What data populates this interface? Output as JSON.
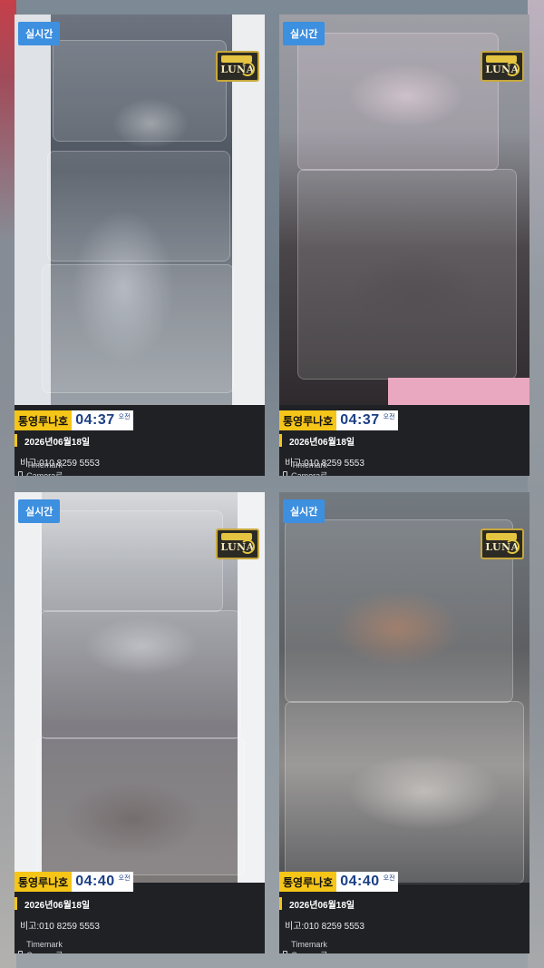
{
  "tiles": [
    {
      "badge": "실시간",
      "logo_text": "LUNA",
      "boat": "통영루나호",
      "time": "04:37",
      "ampm": "오전",
      "date": "2026년06월18일",
      "note": "비고:010 8259 5553",
      "verify": "Timemark Camera로 확인된 시간"
    },
    {
      "badge": "실시간",
      "logo_text": "LUNA",
      "boat": "통영루나호",
      "time": "04:37",
      "ampm": "오전",
      "date": "2026년06월18일",
      "note": "비고:010 8259 5553",
      "verify": "Timemark Camera로 확인된 시간"
    },
    {
      "badge": "실시간",
      "logo_text": "LUNA",
      "boat": "통영루나호",
      "time": "04:40",
      "ampm": "오전",
      "date": "2026년06월18일",
      "note": "비고:010 8259 5553",
      "verify": "Timemark Camera로 확인된 시간"
    },
    {
      "badge": "실시간",
      "logo_text": "LUNA",
      "boat": "통영루나호",
      "time": "04:40",
      "ampm": "오전",
      "date": "2026년06월18일",
      "note": "비고:010 8259 5553",
      "verify": "Timemark Camera로 확인된 시간"
    }
  ]
}
